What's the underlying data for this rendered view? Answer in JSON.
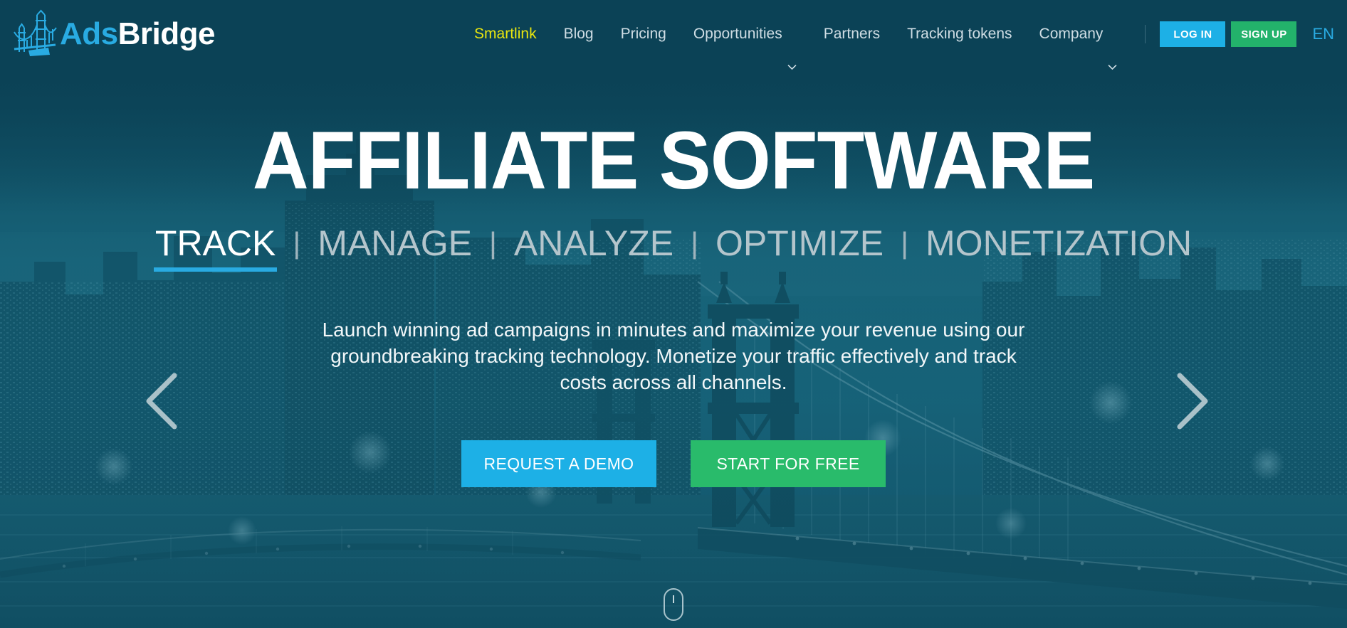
{
  "brand": {
    "logo_icon": "bridge-icon",
    "name_part1": "Ads",
    "name_part2": "Bridge",
    "accent_color": "#29abe2",
    "header_bg": "#0b4256"
  },
  "nav": {
    "items": [
      {
        "label": "Smartlink",
        "active": true,
        "has_caret": false
      },
      {
        "label": "Blog",
        "active": false,
        "has_caret": false
      },
      {
        "label": "Pricing",
        "active": false,
        "has_caret": false
      },
      {
        "label": "Opportunities",
        "active": false,
        "has_caret": true
      },
      {
        "label": "Partners",
        "active": false,
        "has_caret": false
      },
      {
        "label": "Tracking tokens",
        "active": false,
        "has_caret": false
      },
      {
        "label": "Company",
        "active": false,
        "has_caret": true
      }
    ],
    "login_label": "LOG IN",
    "signup_label": "SIGN UP",
    "login_color": "#1db0e6",
    "signup_color": "#23b26b",
    "language": "EN",
    "active_color": "#e9e60f"
  },
  "hero": {
    "title": "AFFILIATE SOFTWARE",
    "tabs": [
      {
        "label": "TRACK",
        "active": true
      },
      {
        "label": "MANAGE",
        "active": false
      },
      {
        "label": "ANALYZE",
        "active": false
      },
      {
        "label": "OPTIMIZE",
        "active": false
      },
      {
        "label": "MONETIZATION",
        "active": false
      }
    ],
    "tab_divider": "|",
    "description": "Launch winning ad campaigns in minutes and maximize your revenue using our groundbreaking tracking technology. Monetize your traffic effectively and track costs across all channels.",
    "cta_primary": "REQUEST A DEMO",
    "cta_secondary": "START FOR FREE",
    "cta_primary_color": "#1db0e6",
    "cta_secondary_color": "#29bb6b",
    "underline_color": "#29abe2",
    "prev_icon": "chevron-left-icon",
    "next_icon": "chevron-right-icon",
    "scroll_icon": "mouse-scroll-icon",
    "background_image": "night-cityscape-bridge"
  }
}
